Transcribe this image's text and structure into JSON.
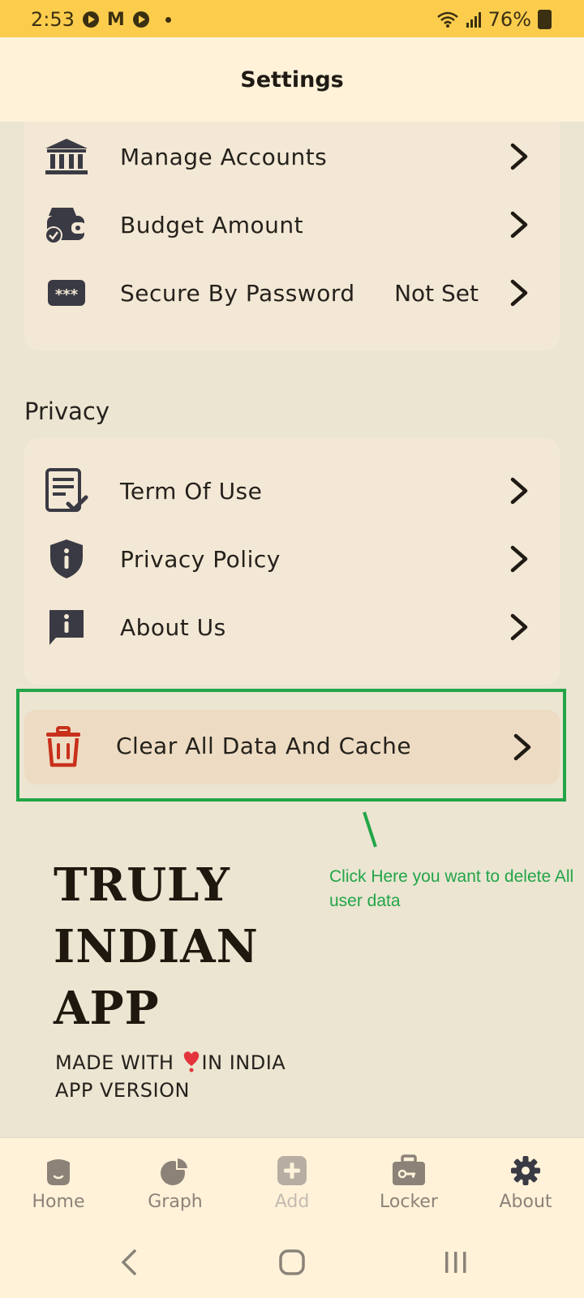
{
  "status_bar": {
    "time": "2:53",
    "battery": "76%"
  },
  "header": {
    "title": "Settings"
  },
  "general": {
    "items": [
      {
        "label": "Manage Accounts",
        "icon": "bank-icon"
      },
      {
        "label": "Budget Amount",
        "icon": "wallet-icon"
      },
      {
        "label": "Secure By Password",
        "value": "Not Set",
        "icon": "password-icon"
      }
    ]
  },
  "privacy": {
    "title": "Privacy",
    "items": [
      {
        "label": "Term Of Use",
        "icon": "document-check-icon"
      },
      {
        "label": "Privacy Policy",
        "icon": "shield-icon"
      },
      {
        "label": "About Us",
        "icon": "info-chat-icon"
      }
    ]
  },
  "clear_data": {
    "label": "Clear All Data And Cache",
    "icon": "trash-icon"
  },
  "annotation": {
    "text": "Click Here you want to delete All  user data",
    "color": "#22a548"
  },
  "branding": {
    "line1": "TRULY",
    "line2": "INDIAN",
    "line3": "APP",
    "made_with_prefix": "MADE WITH ",
    "made_with_suffix": "IN INDIA",
    "version": "APP VERSION"
  },
  "bottom_nav": {
    "items": [
      {
        "label": "Home",
        "icon": "home-icon"
      },
      {
        "label": "Graph",
        "icon": "pie-chart-icon"
      },
      {
        "label": "Add",
        "icon": "add-icon"
      },
      {
        "label": "Locker",
        "icon": "briefcase-icon"
      },
      {
        "label": "About",
        "icon": "gear-icon"
      }
    ]
  },
  "colors": {
    "status_bar": "#fccd4d",
    "header": "#fff2d9",
    "background": "#ebe5d2",
    "card": "#f3e8d5",
    "danger": "#c8301c"
  }
}
